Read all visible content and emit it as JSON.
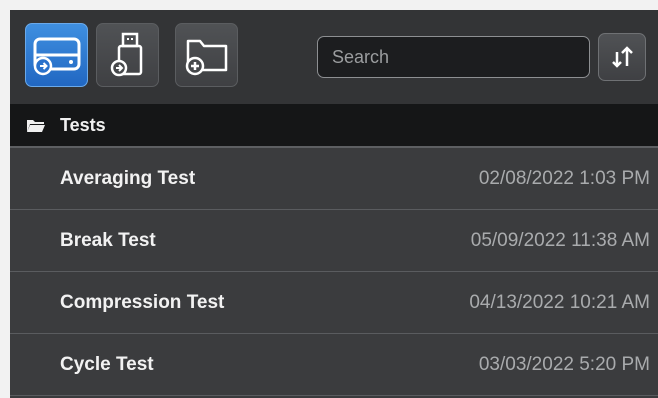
{
  "toolbar": {
    "buttons": [
      {
        "icon": "drive-icon",
        "active": true
      },
      {
        "icon": "usb-drive-icon",
        "active": false
      },
      {
        "icon": "add-folder-icon",
        "active": false
      }
    ],
    "search": {
      "placeholder": "Search",
      "value": ""
    },
    "sort_icon": "sort-icon"
  },
  "header": {
    "icon": "open-folder-icon",
    "title": "Tests"
  },
  "tests": [
    {
      "name": "Averaging Test",
      "date": "02/08/2022 1:03 PM"
    },
    {
      "name": "Break Test",
      "date": "05/09/2022 11:38 AM"
    },
    {
      "name": "Compression Test",
      "date": "04/13/2022 10:21 AM"
    },
    {
      "name": "Cycle Test",
      "date": "03/03/2022 5:20 PM"
    }
  ],
  "colors": {
    "accent": "#2f7fd8",
    "panel": "#3a3b3d",
    "header": "#151617"
  }
}
